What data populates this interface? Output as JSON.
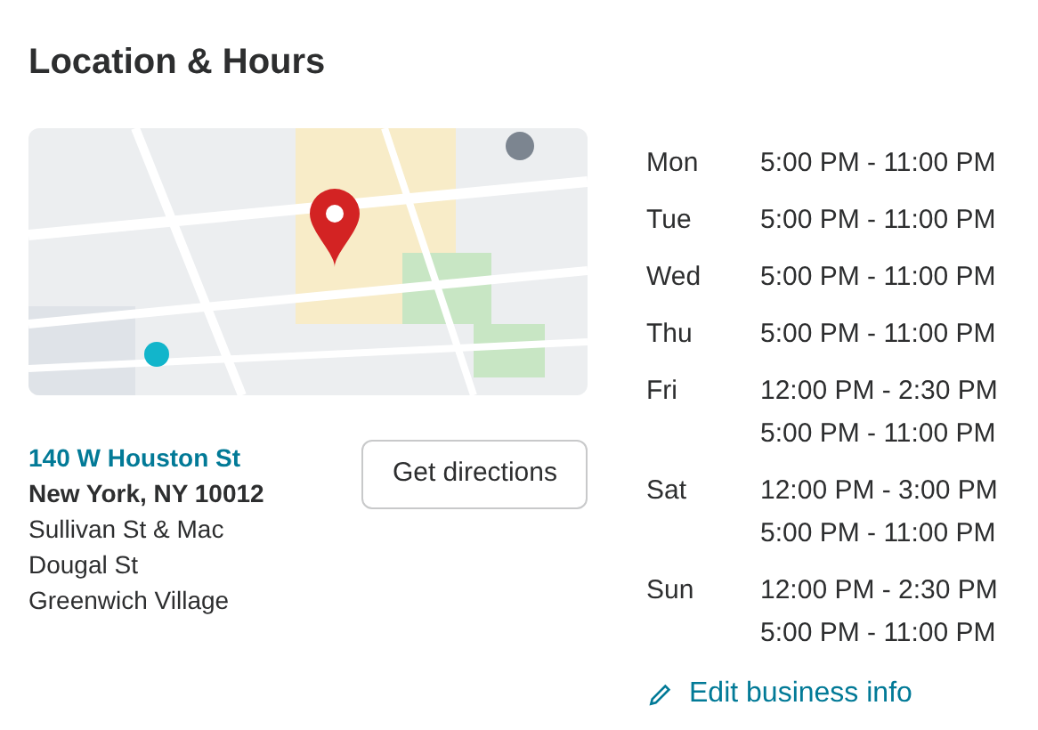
{
  "title": "Location & Hours",
  "address": {
    "street": "140 W Houston St",
    "city": "New York, NY 10012",
    "cross_streets": [
      "Sullivan St & Mac",
      "Dougal St",
      "Greenwich Village"
    ]
  },
  "directions_button": "Get directions",
  "hours": [
    {
      "day": "Mon",
      "times": [
        "5:00 PM - 11:00 PM"
      ]
    },
    {
      "day": "Tue",
      "times": [
        "5:00 PM - 11:00 PM"
      ]
    },
    {
      "day": "Wed",
      "times": [
        "5:00 PM - 11:00 PM"
      ]
    },
    {
      "day": "Thu",
      "times": [
        "5:00 PM - 11:00 PM"
      ]
    },
    {
      "day": "Fri",
      "times": [
        "12:00 PM - 2:30 PM",
        "5:00 PM - 11:00 PM"
      ]
    },
    {
      "day": "Sat",
      "times": [
        "12:00 PM - 3:00 PM",
        "5:00 PM - 11:00 PM"
      ]
    },
    {
      "day": "Sun",
      "times": [
        "12:00 PM - 2:30 PM",
        "5:00 PM - 11:00 PM"
      ]
    }
  ],
  "edit_link": "Edit business info"
}
